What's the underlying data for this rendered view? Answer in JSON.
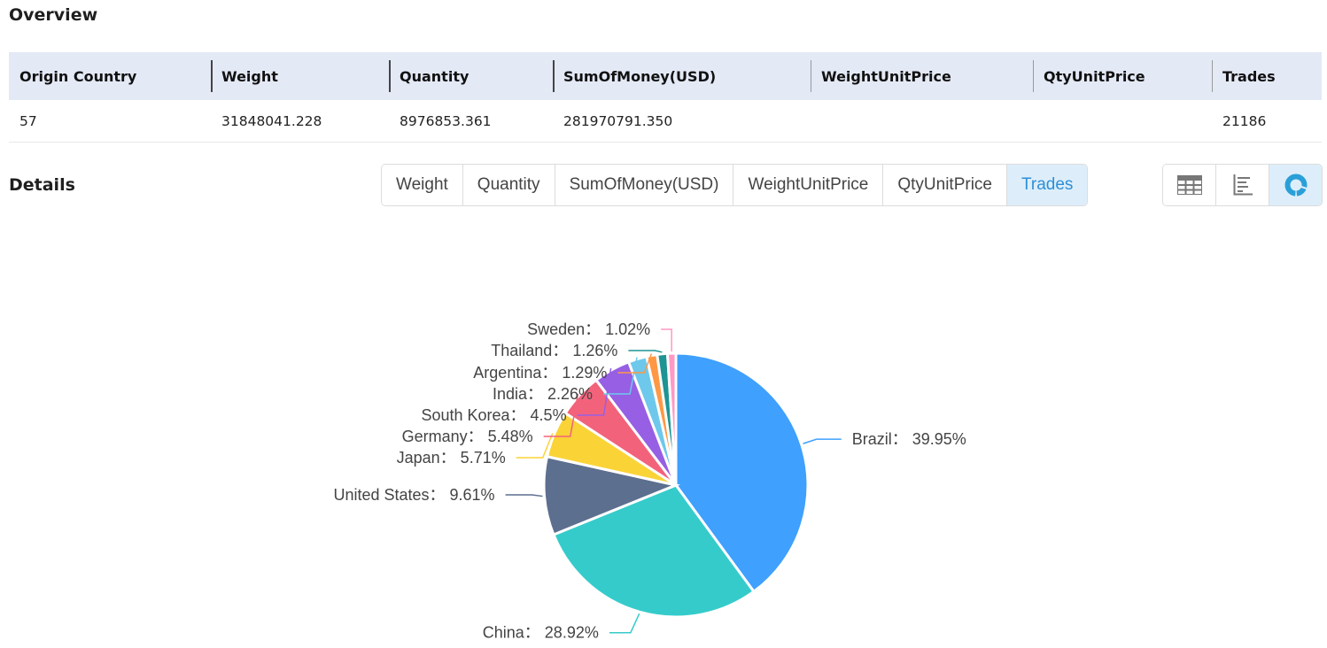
{
  "overview": {
    "title": "Overview",
    "columns": [
      "Origin Country",
      "Weight",
      "Quantity",
      "SumOfMoney(USD)",
      "WeightUnitPrice",
      "QtyUnitPrice",
      "Trades"
    ],
    "row": [
      "57",
      "31848041.228",
      "8976853.361",
      "281970791.350",
      "",
      "",
      "21186"
    ]
  },
  "details": {
    "title": "Details",
    "metric_tabs": [
      {
        "label": "Weight",
        "active": false
      },
      {
        "label": "Quantity",
        "active": false
      },
      {
        "label": "SumOfMoney(USD)",
        "active": false
      },
      {
        "label": "WeightUnitPrice",
        "active": false
      },
      {
        "label": "QtyUnitPrice",
        "active": false
      },
      {
        "label": "Trades",
        "active": true
      }
    ],
    "view_tabs": [
      {
        "icon": "table-icon",
        "active": false
      },
      {
        "icon": "bar-chart-icon",
        "active": false
      },
      {
        "icon": "pie-chart-icon",
        "active": true
      }
    ],
    "accent_color": "#2c8fd6"
  },
  "chart_data": {
    "type": "pie",
    "title": "",
    "metric": "Trades",
    "label_separator": "：",
    "slices": [
      {
        "name": "Brazil",
        "value": 39.95,
        "label": "39.95%",
        "color": "#3fa0fd"
      },
      {
        "name": "China",
        "value": 28.92,
        "label": "28.92%",
        "color": "#36cbcb"
      },
      {
        "name": "United States",
        "value": 9.61,
        "label": "9.61%",
        "color": "#5d6f8f"
      },
      {
        "name": "Japan",
        "value": 5.71,
        "label": "5.71%",
        "color": "#fad337"
      },
      {
        "name": "Germany",
        "value": 5.48,
        "label": "5.48%",
        "color": "#f2637b"
      },
      {
        "name": "South Korea",
        "value": 4.5,
        "label": "4.5%",
        "color": "#975fe4"
      },
      {
        "name": "India",
        "value": 2.26,
        "label": "2.26%",
        "color": "#6dc8ec"
      },
      {
        "name": "Argentina",
        "value": 1.29,
        "label": "1.29%",
        "color": "#ff9845"
      },
      {
        "name": "Thailand",
        "value": 1.26,
        "label": "1.26%",
        "color": "#1e9493"
      },
      {
        "name": "Sweden",
        "value": 1.02,
        "label": "1.02%",
        "color": "#ff99c3"
      }
    ],
    "legend": "none",
    "start_angle": "12 o'clock, clockwise"
  }
}
